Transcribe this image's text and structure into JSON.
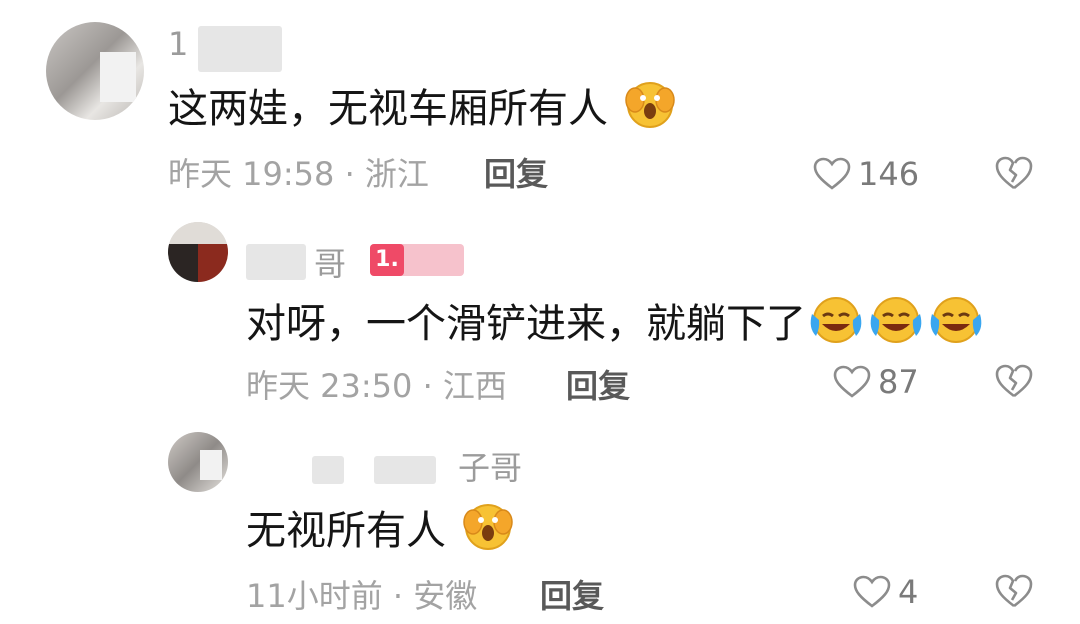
{
  "colors": {
    "text": "#151515",
    "meta": "#a3a3a3",
    "reply": "#595959",
    "icon": "#8c8c8c"
  },
  "comments": [
    {
      "username": "1",
      "text": "这两娃，无视车厢所有人",
      "emoji": "scared-face",
      "time": "昨天 19:58 · 浙江",
      "reply": "回复",
      "likes": "146"
    },
    {
      "username": "哥",
      "level": "1.",
      "text": "对呀，一个滑铲进来，就躺下了",
      "emoji": "crying-laughing-face",
      "emoji_count": 3,
      "time": "昨天 23:50 · 江西",
      "reply": "回复",
      "likes": "87"
    },
    {
      "username": "子哥",
      "text": "无视所有人",
      "emoji": "scared-face",
      "time": "11小时前 · 安徽",
      "reply": "回复",
      "likes": "4"
    }
  ]
}
